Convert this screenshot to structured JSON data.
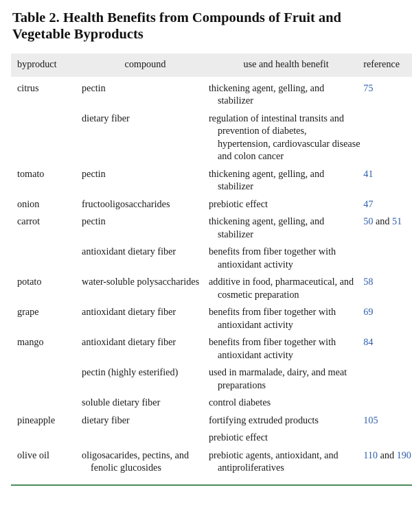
{
  "caption": "Table 2. Health Benefits from Compounds of Fruit and Vegetable Byproducts",
  "columns": [
    "byproduct",
    "compound",
    "use and health benefit",
    "reference"
  ],
  "colors": {
    "header_bg": "#ececec",
    "reference_link": "#2d5ea8",
    "bottom_rule": "#4a8a5a"
  },
  "rows": [
    {
      "byproduct": "citrus",
      "compound": "pectin",
      "benefit": "thickening agent, gelling, and stabilizer",
      "refs": [
        "75"
      ],
      "ref_sep": ""
    },
    {
      "byproduct": "",
      "compound": "dietary fiber",
      "benefit": "regulation of intestinal transits and prevention of diabetes, hypertension, cardiovascular disease and colon cancer",
      "refs": [],
      "ref_sep": ""
    },
    {
      "byproduct": "tomato",
      "compound": "pectin",
      "benefit": "thickening agent, gelling, and stabilizer",
      "refs": [
        "41"
      ],
      "ref_sep": ""
    },
    {
      "byproduct": "onion",
      "compound": "fructooligosaccharides",
      "benefit": "prebiotic effect",
      "refs": [
        "47"
      ],
      "ref_sep": ""
    },
    {
      "byproduct": "carrot",
      "compound": "pectin",
      "benefit": "thickening agent, gelling, and stabilizer",
      "refs": [
        "50",
        "51"
      ],
      "ref_sep": " and "
    },
    {
      "byproduct": "",
      "compound": "antioxidant dietary fiber",
      "benefit": "benefits from fiber together with antioxidant activity",
      "refs": [],
      "ref_sep": ""
    },
    {
      "byproduct": "potato",
      "compound": "water-soluble polysaccharides",
      "benefit": "additive in food, pharmaceutical, and cosmetic preparation",
      "refs": [
        "58"
      ],
      "ref_sep": ""
    },
    {
      "byproduct": "grape",
      "compound": "antioxidant dietary fiber",
      "benefit": "benefits from fiber together with antioxidant activity",
      "refs": [
        "69"
      ],
      "ref_sep": ""
    },
    {
      "byproduct": "mango",
      "compound": "antioxidant dietary fiber",
      "benefit": "benefits from fiber together with antioxidant activity",
      "refs": [
        "84"
      ],
      "ref_sep": ""
    },
    {
      "byproduct": "",
      "compound": "pectin (highly esterified)",
      "benefit": "used in marmalade, dairy, and meat preparations",
      "refs": [],
      "ref_sep": ""
    },
    {
      "byproduct": "",
      "compound": "soluble dietary fiber",
      "benefit": "control diabetes",
      "refs": [],
      "ref_sep": ""
    },
    {
      "byproduct": "pineapple",
      "compound": "dietary fiber",
      "benefit": "fortifying extruded products",
      "refs": [
        "105"
      ],
      "ref_sep": ""
    },
    {
      "byproduct": "",
      "compound": "",
      "benefit": "prebiotic effect",
      "refs": [],
      "ref_sep": ""
    },
    {
      "byproduct": "olive oil",
      "compound": "oligosacarides, pectins, and fenolic glucosides",
      "benefit": "prebiotic agents, antioxidant, and antiproliferatives",
      "refs": [
        "110",
        "190"
      ],
      "ref_sep": " and "
    }
  ]
}
